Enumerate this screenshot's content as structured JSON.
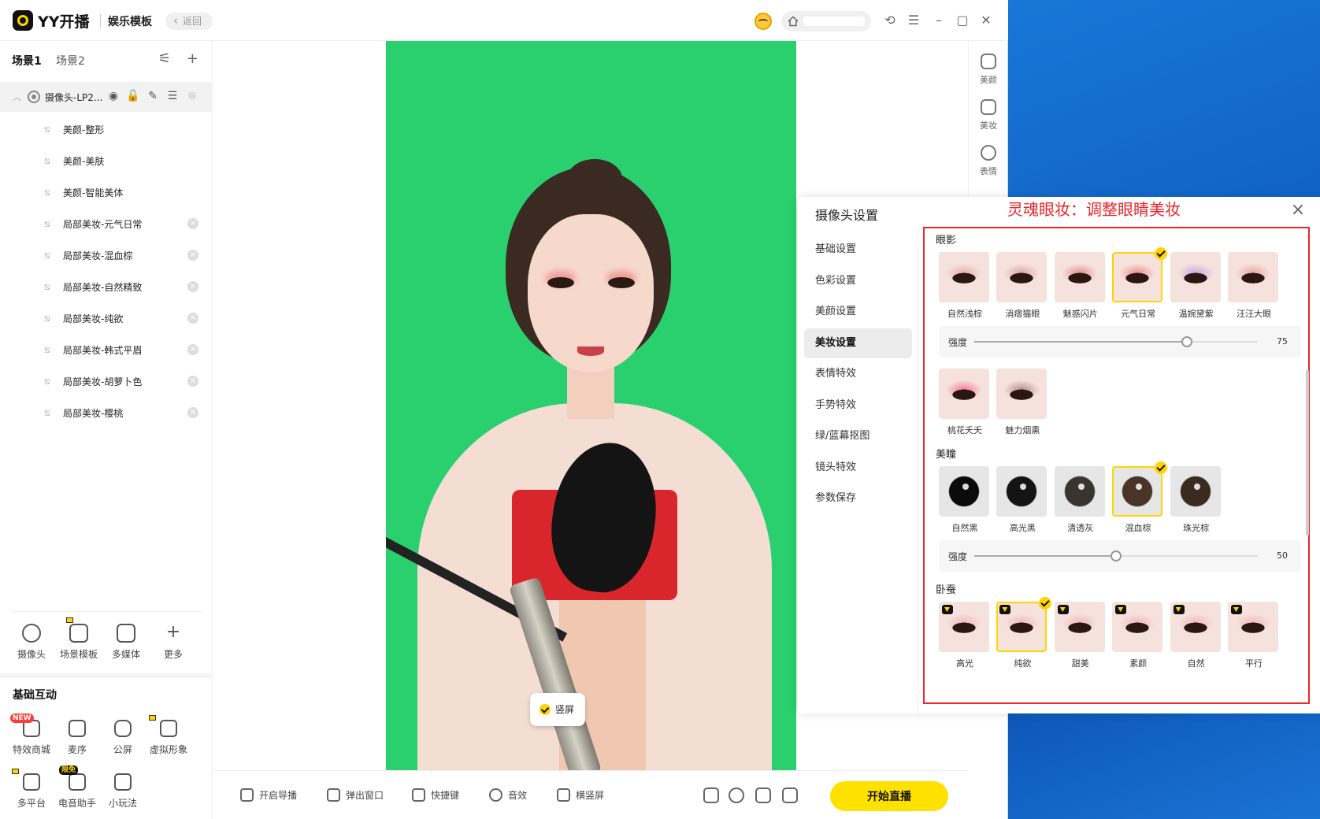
{
  "titlebar": {
    "app_name": "YY开播",
    "sub_title": "娱乐模板",
    "back_label": "返回"
  },
  "sidebar": {
    "scene_tabs": [
      "场景1",
      "场景2"
    ],
    "source": {
      "label": "摄像头-LP2..."
    },
    "filters": [
      {
        "label": "美颜-整形",
        "closable": false
      },
      {
        "label": "美颜-美肤",
        "closable": false
      },
      {
        "label": "美颜-智能美体",
        "closable": false
      },
      {
        "label": "局部美妆-元气日常",
        "closable": true
      },
      {
        "label": "局部美妆-混血棕",
        "closable": true
      },
      {
        "label": "局部美妆-自然精致",
        "closable": true
      },
      {
        "label": "局部美妆-纯欲",
        "closable": true
      },
      {
        "label": "局部美妆-韩式平眉",
        "closable": true
      },
      {
        "label": "局部美妆-胡萝卜色",
        "closable": true
      },
      {
        "label": "局部美妆-樱桃",
        "closable": true
      }
    ],
    "quick_items": [
      "摄像头",
      "场景模板",
      "多媒体",
      "更多"
    ],
    "interact_title": "基础互动",
    "interact_items": [
      {
        "label": "特效商城",
        "badge": "NEW"
      },
      {
        "label": "麦序",
        "badge": ""
      },
      {
        "label": "公屏",
        "badge": ""
      },
      {
        "label": "虚拟形象",
        "badge": "vip"
      },
      {
        "label": "多平台",
        "badge": "vip"
      },
      {
        "label": "电音助手",
        "badge": "限免"
      },
      {
        "label": "小玩法",
        "badge": ""
      }
    ]
  },
  "preview": {
    "orientation_label": "竖屏"
  },
  "tool_column": [
    "美颜",
    "美妆",
    "表情"
  ],
  "bottom_bar": {
    "items": [
      "开启导播",
      "弹出窗口",
      "快捷键",
      "音效",
      "横竖屏"
    ],
    "live_button": "开始直播"
  },
  "settings_panel": {
    "title": "摄像头设置",
    "annotation": "灵魂眼妆：调整眼睛美妆",
    "nav": [
      "基础设置",
      "色彩设置",
      "美颜设置",
      "美妆设置",
      "表情特效",
      "手势特效",
      "绿/蓝幕抠图",
      "镜头特效",
      "参数保存"
    ],
    "active_nav": "美妆设置",
    "eyeshadow": {
      "title": "眼影",
      "options": [
        "自然浅棕",
        "消痞猫眼",
        "魅惑闪片",
        "元气日常",
        "温婉黛紫",
        "汪汪大眼",
        "桃花夭夭",
        "魅力烟熏"
      ],
      "selected": "元气日常",
      "strength_label": "强度",
      "strength": 75
    },
    "pupil": {
      "title": "美瞳",
      "options": [
        "自然黑",
        "高光黑",
        "清透灰",
        "混血棕",
        "珠光棕"
      ],
      "selected": "混血棕",
      "strength_label": "强度",
      "strength": 50
    },
    "aegyo": {
      "title": "卧蚕",
      "options": [
        "高光",
        "纯欲",
        "甜美",
        "素颜",
        "自然",
        "平行"
      ],
      "selected": "纯欲"
    }
  },
  "colors": {
    "accent_yellow": "#ffe100",
    "annotation_red": "#e8262c",
    "greenscreen": "#2ad06e"
  }
}
